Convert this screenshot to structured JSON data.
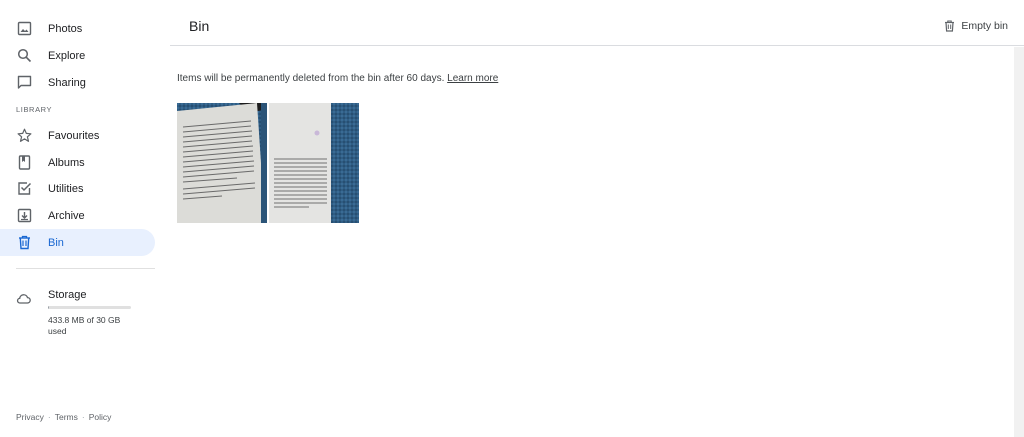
{
  "sidebar": {
    "items": [
      {
        "label": "Photos",
        "icon": "photos-icon"
      },
      {
        "label": "Explore",
        "icon": "search-icon"
      },
      {
        "label": "Sharing",
        "icon": "chat-icon"
      }
    ],
    "library_header": "LIBRARY",
    "library_items": [
      {
        "label": "Favourites",
        "icon": "star-icon"
      },
      {
        "label": "Albums",
        "icon": "bookmark-icon"
      },
      {
        "label": "Utilities",
        "icon": "check-box-icon"
      },
      {
        "label": "Archive",
        "icon": "archive-icon"
      },
      {
        "label": "Bin",
        "icon": "trash-icon",
        "active": true
      }
    ],
    "storage": {
      "title": "Storage",
      "detail": "433.8 MB of 30 GB used",
      "used_fraction": 0.014
    },
    "footer": {
      "privacy": "Privacy",
      "terms": "Terms",
      "policy": "Policy",
      "separator": "·"
    }
  },
  "header": {
    "title": "Bin",
    "empty_bin_label": "Empty bin"
  },
  "main": {
    "notice": "Items will be permanently deleted from the bin after 60 days.",
    "learn_more": "Learn more",
    "photos": [
      {
        "description": "open book page on blue fabric"
      },
      {
        "description": "book page on blue fabric"
      }
    ]
  },
  "colors": {
    "active_bg": "#e8f0fe",
    "active_text": "#1967d2",
    "fabric": "#2c5f8a"
  }
}
